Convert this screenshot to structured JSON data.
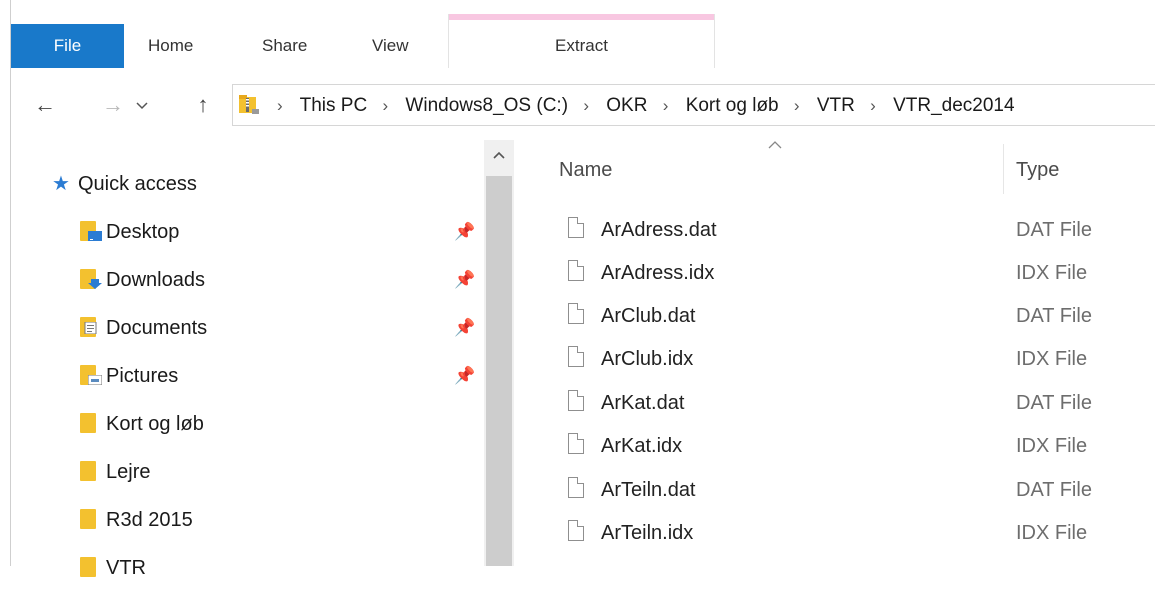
{
  "ribbon": {
    "tabs": [
      "File",
      "Home",
      "Share",
      "View",
      "Extract"
    ],
    "context_accent": "#f8c7e1",
    "file_tab_color": "#1979ca"
  },
  "nav": {
    "back_icon": "←",
    "forward_icon": "→",
    "recent_icon": "⌄",
    "up_icon": "↑",
    "breadcrumb": [
      "This PC",
      "Windows8_OS (C:)",
      "OKR",
      "Kort og løb",
      "VTR",
      "VTR_dec2014"
    ]
  },
  "sidebar": {
    "quick_access": "Quick access",
    "items": [
      {
        "label": "Desktop",
        "pinned": true,
        "icon": "desktop-folder-icon"
      },
      {
        "label": "Downloads",
        "pinned": true,
        "icon": "downloads-folder-icon"
      },
      {
        "label": "Documents",
        "pinned": true,
        "icon": "documents-folder-icon"
      },
      {
        "label": "Pictures",
        "pinned": true,
        "icon": "pictures-folder-icon"
      },
      {
        "label": "Kort og løb",
        "pinned": false,
        "icon": "folder-icon"
      },
      {
        "label": "Lejre",
        "pinned": false,
        "icon": "folder-icon"
      },
      {
        "label": "R3d 2015",
        "pinned": false,
        "icon": "folder-icon"
      },
      {
        "label": "VTR",
        "pinned": false,
        "icon": "folder-icon"
      }
    ]
  },
  "files": {
    "columns": {
      "name": "Name",
      "type": "Type"
    },
    "rows": [
      {
        "name": "ArAdress.dat",
        "type": "DAT File"
      },
      {
        "name": "ArAdress.idx",
        "type": "IDX File"
      },
      {
        "name": "ArClub.dat",
        "type": "DAT File"
      },
      {
        "name": "ArClub.idx",
        "type": "IDX File"
      },
      {
        "name": "ArKat.dat",
        "type": "DAT File"
      },
      {
        "name": "ArKat.idx",
        "type": "IDX File"
      },
      {
        "name": "ArTeiln.dat",
        "type": "DAT File"
      },
      {
        "name": "ArTeiln.idx",
        "type": "IDX File"
      }
    ]
  }
}
